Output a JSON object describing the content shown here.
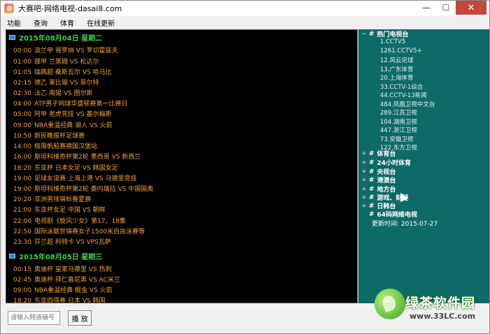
{
  "window": {
    "title": "大赛吧-网络电视-dasai8.com",
    "minimize": "—",
    "maximize": "☐",
    "close": "✕"
  },
  "menu": [
    "功能",
    "查询",
    "体育",
    "在线更新"
  ],
  "schedule": {
    "day1": {
      "label": "2015年08月04日 星期二",
      "items": [
        {
          "time": "00:00",
          "text": "波兰甲 哥罗纳 VS 罗切霍兹夫"
        },
        {
          "time": "01:00",
          "text": "挪甲 兰黑姆 VS 松达尔"
        },
        {
          "time": "01:05",
          "text": "瑞典超 桑斯瓦尔 VS 哈马比"
        },
        {
          "time": "02:15",
          "text": "德乙 莱比锡 VS 菲尔特"
        },
        {
          "time": "02:30",
          "text": "法乙 南锡 VS 图尔斯"
        },
        {
          "time": "04:00",
          "text": "ATP男子网球华盛顿赛第一比赛日"
        },
        {
          "time": "05:00",
          "text": "阿甲 老虎竞技 VS 基尔梅斯"
        },
        {
          "time": "09:00",
          "text": "NBA重温经典 湖人 VS 火箭"
        },
        {
          "time": "10:50",
          "text": "新民晚报杯足球赛"
        },
        {
          "time": "14:00",
          "text": "极限帆船赛德国汉堡站"
        },
        {
          "time": "16:00",
          "text": "斯坦科维奇杯第2轮 墨西哥 VS 新西兰"
        },
        {
          "time": "18:20",
          "text": "东亚杯 日本女足 VS 韩国女足"
        },
        {
          "time": "19:00",
          "text": "足球友谊赛 上海上港 VS 马德里竞技"
        },
        {
          "time": "19:00",
          "text": "斯坦科维奇杯第2轮 委内瑞拉 VS 中国国奥"
        },
        {
          "time": "20:20",
          "text": "亚洲男排锦标赛夏赛"
        },
        {
          "time": "21:00",
          "text": "东亚杯女足 中国 VS 朝鲜"
        },
        {
          "time": "22:00",
          "text": "电视剧《旋风少女》第17、18集"
        },
        {
          "time": "22:50",
          "text": "国际泳联世锦赛女子1500米自由泳赛等"
        },
        {
          "time": "23:30",
          "text": "芬兰超 科特卡 VS VPS瓦萨"
        }
      ]
    },
    "day2": {
      "label": "2015年08月05日 星期三",
      "items": [
        {
          "time": "00:15",
          "text": "奥迪杯 皇家马德里 VS 热刺"
        },
        {
          "time": "02:45",
          "text": "奥迪杯 拜仁慕尼黑 VS AC米兰"
        },
        {
          "time": "09:00",
          "text": "NBA重温经典 掘金 VS 火箭"
        },
        {
          "time": "18:20",
          "text": "东亚四强赛 日本 VS 韩国"
        }
      ]
    }
  },
  "tree": {
    "hot": {
      "expander": "−",
      "label": "热门电视台",
      "channels": [
        "1.CCTV5",
        "1261.CCTV5+",
        "12.风云足球",
        "13.广东体育",
        "20.上海体育",
        "33.CCTV-1综合",
        "44.CCTV-13新闻",
        "484.凤凰卫视中文台",
        "289.江苏卫视",
        "104.湖南卫视",
        "447.浙江卫视",
        "73.安徽卫视",
        "122.东方卫视"
      ]
    },
    "groups": [
      {
        "expander": "+",
        "label": "体育台"
      },
      {
        "expander": "+",
        "label": "24小时体育"
      },
      {
        "expander": "+",
        "label": "央视台"
      },
      {
        "expander": "+",
        "label": "港澳台"
      },
      {
        "expander": "+",
        "label": "地方台"
      },
      {
        "expander": "+",
        "label": "游戏、财经"
      },
      {
        "expander": "+",
        "label": "日韩台"
      },
      {
        "expander": "",
        "label": "64码网络电视"
      }
    ],
    "update": "更新时间: 2015-07-27"
  },
  "controls": {
    "input_placeholder": "请输入频道编号",
    "play_label": "播 放"
  },
  "watermark": {
    "text": "绿茶软件园",
    "url": "www.33LC.com"
  }
}
